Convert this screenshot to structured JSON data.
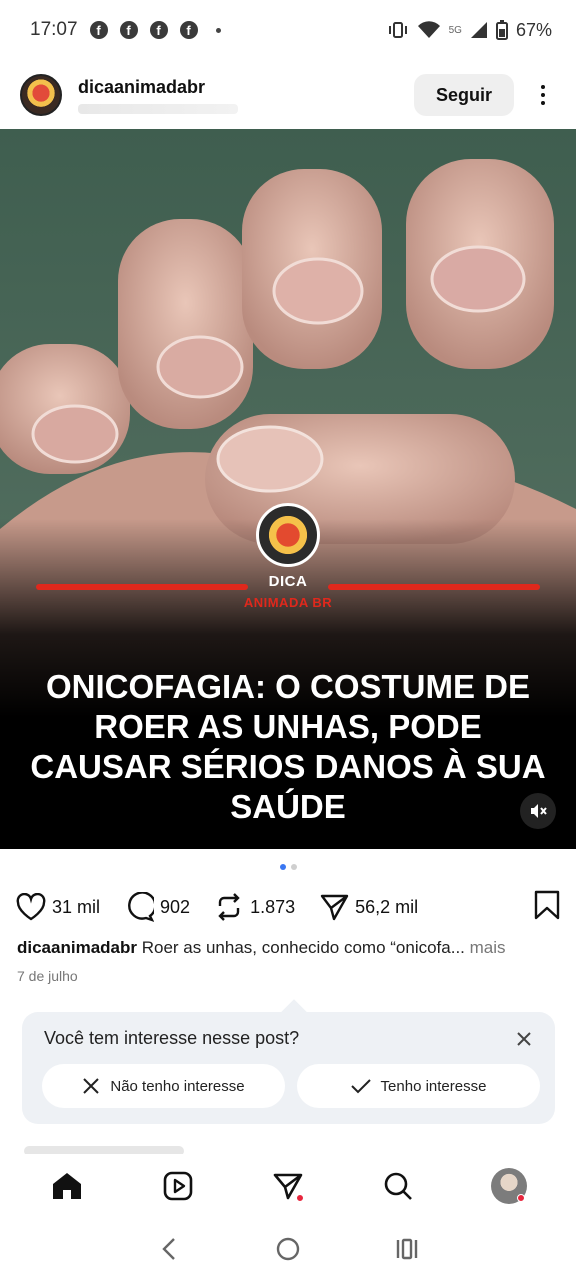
{
  "status_bar": {
    "time": "17:07",
    "battery": "67%",
    "network": "5G"
  },
  "post": {
    "username": "dicaanimadabr",
    "follow_label": "Seguir",
    "media": {
      "brand_top": "DICA",
      "brand_bottom": "ANIMADA BR",
      "headline": "ONICOFAGIA: O COSTUME DE ROER AS UNHAS, PODE CAUSAR SÉRIOS DANOS À SUA SAÚDE"
    },
    "likes": "31 mil",
    "comments": "902",
    "reposts": "1.873",
    "shares": "56,2 mil",
    "caption_user": "dicaanimadabr",
    "caption_text": " Roer as unhas, conhecido como “onicofa...",
    "caption_more": " mais",
    "date": "7 de julho"
  },
  "interest": {
    "question": "Você tem interesse nesse post?",
    "no_label": "Não tenho interesse",
    "yes_label": "Tenho interesse"
  },
  "icons": [
    "heart-icon",
    "comment-icon",
    "repost-icon",
    "share-icon",
    "bookmark-icon",
    "home-icon",
    "reels-icon",
    "direct-icon",
    "search-icon",
    "profile-icon",
    "mute-icon"
  ],
  "colors": {
    "brand_red": "#e0281c",
    "pager_active": "#3a77f2",
    "notify_red": "#e8263d"
  }
}
